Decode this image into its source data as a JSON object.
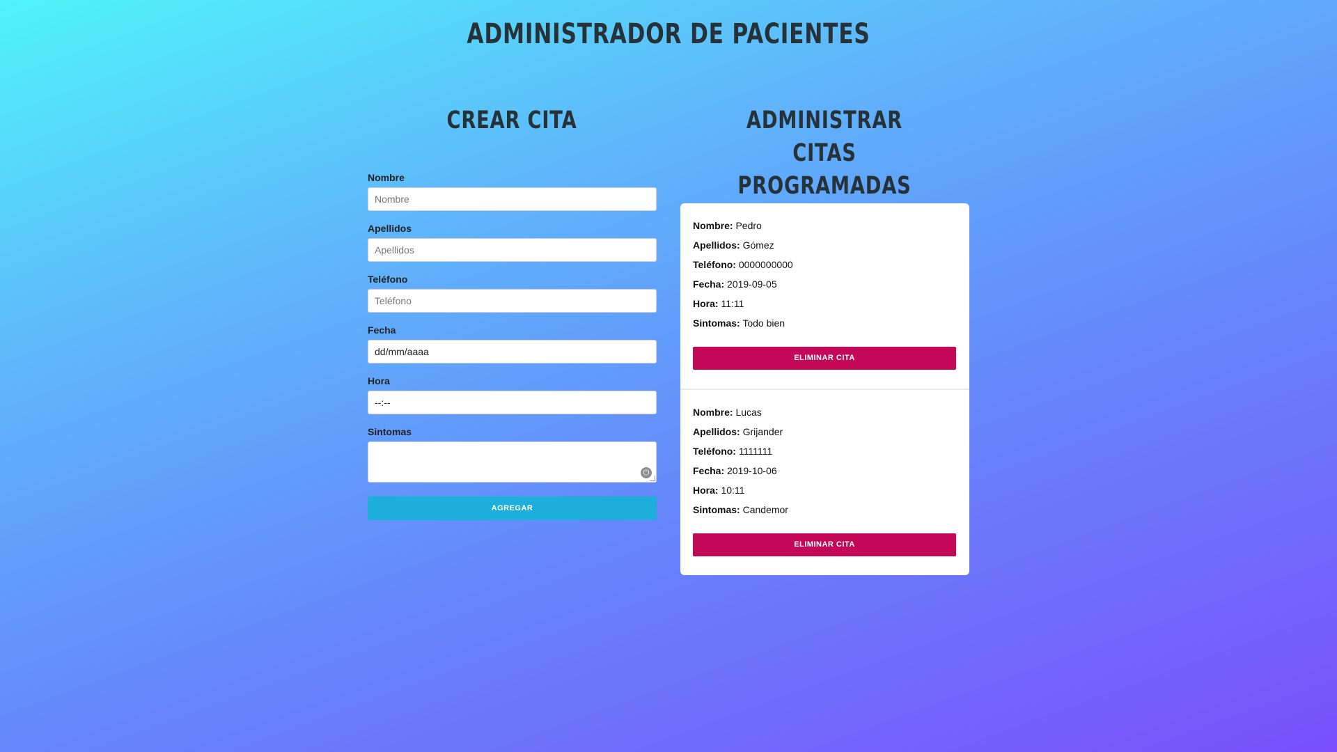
{
  "page_title": "ADMINISTRADOR DE PACIENTES",
  "crear": {
    "title": "CREAR CITA",
    "fields": [
      {
        "label": "Nombre",
        "placeholder": "Nombre",
        "value": ""
      },
      {
        "label": "Apellidos",
        "placeholder": "Apellidos",
        "value": ""
      },
      {
        "label": "Teléfono",
        "placeholder": "Teléfono",
        "value": ""
      },
      {
        "label": "Fecha",
        "placeholder": "",
        "value": "dd/mm/aaaa"
      },
      {
        "label": "Hora",
        "placeholder": "",
        "value": "--:--"
      },
      {
        "label": "Sintomas",
        "placeholder": "",
        "value": ""
      }
    ],
    "submit_label": "AGREGAR"
  },
  "administrar": {
    "title": "ADMINISTRAR CITAS PROGRAMADAS",
    "citas": [
      {
        "nombre_label": "Nombre:",
        "nombre": "Pedro",
        "apellidos_label": "Apellidos:",
        "apellidos": "Gómez",
        "telefono_label": "Teléfono:",
        "telefono": "0000000000",
        "fecha_label": "Fecha:",
        "fecha": "2019-09-05",
        "hora_label": "Hora:",
        "hora": "11:11",
        "sintomas_label": "Sintomas:",
        "sintomas": "Todo bien",
        "delete_label": "ELIMINAR CITA"
      },
      {
        "nombre_label": "Nombre:",
        "nombre": "Lucas",
        "apellidos_label": "Apellidos:",
        "apellidos": "Grijander",
        "telefono_label": "Teléfono:",
        "telefono": "1111111",
        "fecha_label": "Fecha:",
        "fecha": "2019-10-06",
        "hora_label": "Hora:",
        "hora": "10:11",
        "sintomas_label": "Sintomas:",
        "sintomas": "Candemor",
        "delete_label": "ELIMINAR CITA"
      }
    ]
  },
  "colors": {
    "add_button": "#1eaedb",
    "delete_button": "#c40858",
    "title_text": "#263238"
  },
  "icons": {
    "textarea_extension": "grammar-check-icon",
    "textarea_resize": "resize-handle-icon"
  }
}
